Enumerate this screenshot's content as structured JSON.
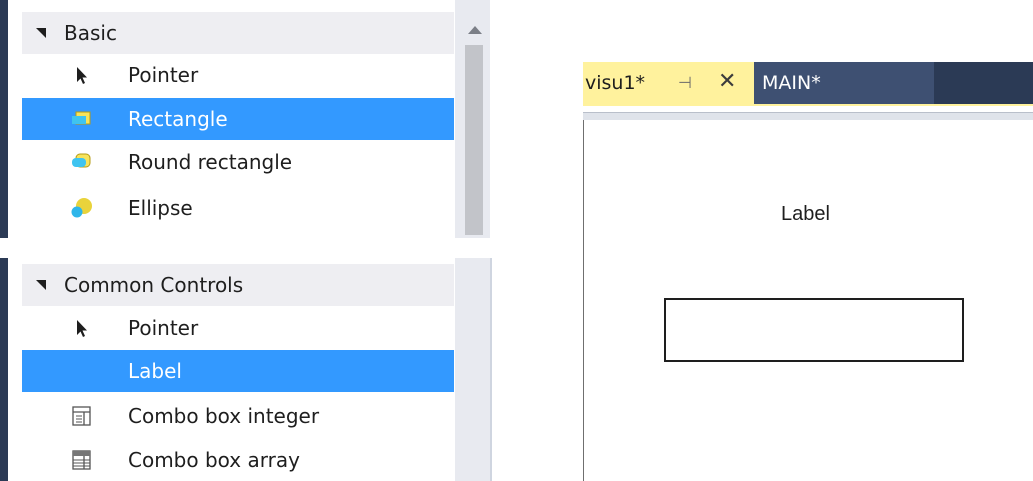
{
  "toolbox": {
    "basic": {
      "header": "Basic",
      "items": [
        {
          "label": "Pointer",
          "icon": "pointer-icon",
          "selected": false
        },
        {
          "label": "Rectangle",
          "icon": "rectangle-icon",
          "selected": true
        },
        {
          "label": "Round rectangle",
          "icon": "round-rectangle-icon",
          "selected": false
        },
        {
          "label": "Ellipse",
          "icon": "ellipse-icon",
          "selected": false
        }
      ]
    },
    "common_controls": {
      "header": "Common Controls",
      "items": [
        {
          "label": "Pointer",
          "icon": "pointer-icon",
          "selected": false
        },
        {
          "label": "Label",
          "icon": "",
          "selected": true
        },
        {
          "label": "Combo box integer",
          "icon": "combo-box-integer-icon",
          "selected": false
        },
        {
          "label": "Combo box array",
          "icon": "combo-box-array-icon",
          "selected": false
        }
      ]
    }
  },
  "editor": {
    "tabs": [
      {
        "label": "visu1*",
        "active": true
      },
      {
        "label": "MAIN*",
        "active": false
      }
    ],
    "pin_glyph": "⊣",
    "close_glyph": "✕",
    "canvas": {
      "label_text": "Label"
    }
  },
  "colors": {
    "selection": "#3399ff",
    "active_tab": "#fff29d",
    "tab_bar": "#2b3a55",
    "inactive_tab": "#3e5072"
  }
}
